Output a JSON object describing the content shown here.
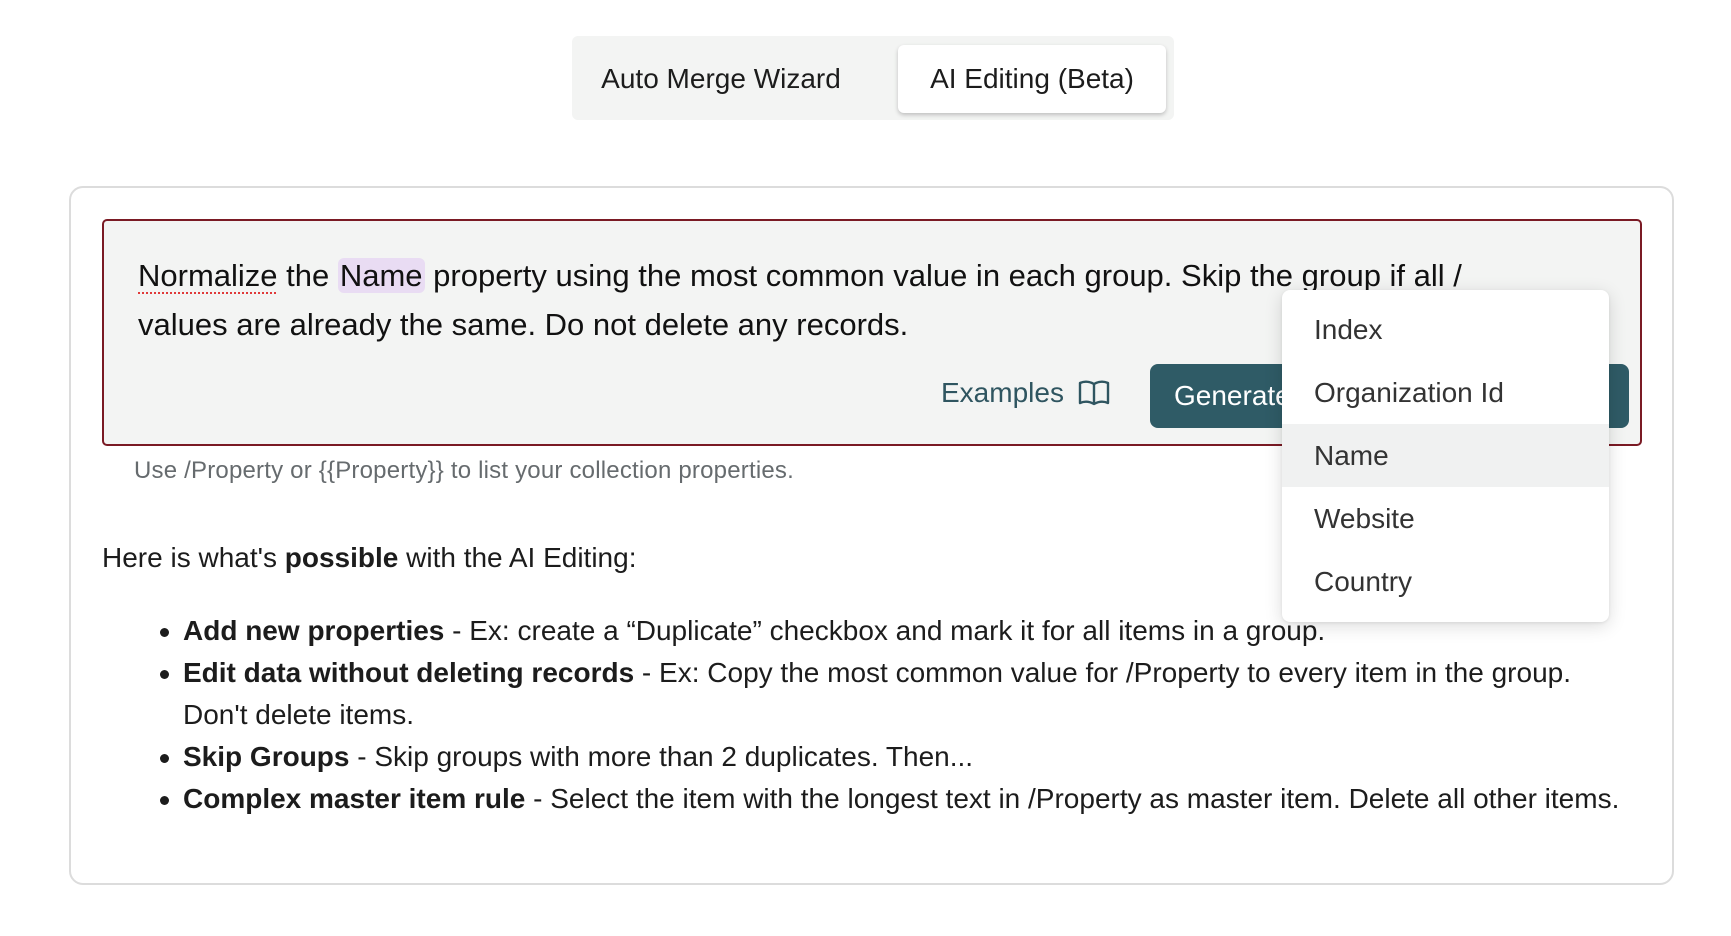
{
  "tabs": [
    {
      "label": "Auto Merge Wizard",
      "active": false
    },
    {
      "label": "AI Editing (Beta)",
      "active": true
    }
  ],
  "prompt": {
    "word1": "Normalize",
    "word2": " the ",
    "token": "Name",
    "rest": " property using the most common value in each group. Skip the group if all /",
    "line2": "values are already the same. Do not delete any records."
  },
  "examples_label": "Examples",
  "generate_label": "Generate",
  "hint": "Use /Property or {{Property}} to list your collection properties.",
  "intro": {
    "before": "Here is what's ",
    "bold": "possible",
    "after": " with the AI Editing:"
  },
  "features": [
    {
      "title": "Add new properties",
      "text": " - Ex: create a “Duplicate” checkbox and mark it for all items in a group."
    },
    {
      "title": "Edit data without deleting records",
      "text": " - Ex: Copy the most common value for /Property to every item in the group. Don't delete items."
    },
    {
      "title": "Skip Groups",
      "text": " - Skip groups with more than 2 duplicates. Then..."
    },
    {
      "title": "Complex master item rule",
      "text": " - Select the item with the longest text in /Property as master item. Delete all other items."
    }
  ],
  "dropdown": {
    "items": [
      "Index",
      "Organization Id",
      "Name",
      "Website",
      "Country"
    ],
    "highlighted": "Name"
  },
  "colors": {
    "primary_button": "#2f5b66",
    "prompt_border": "#7a1a24",
    "token_highlight": "#e9dcf3",
    "panel_bg": "#f3f4f3"
  }
}
